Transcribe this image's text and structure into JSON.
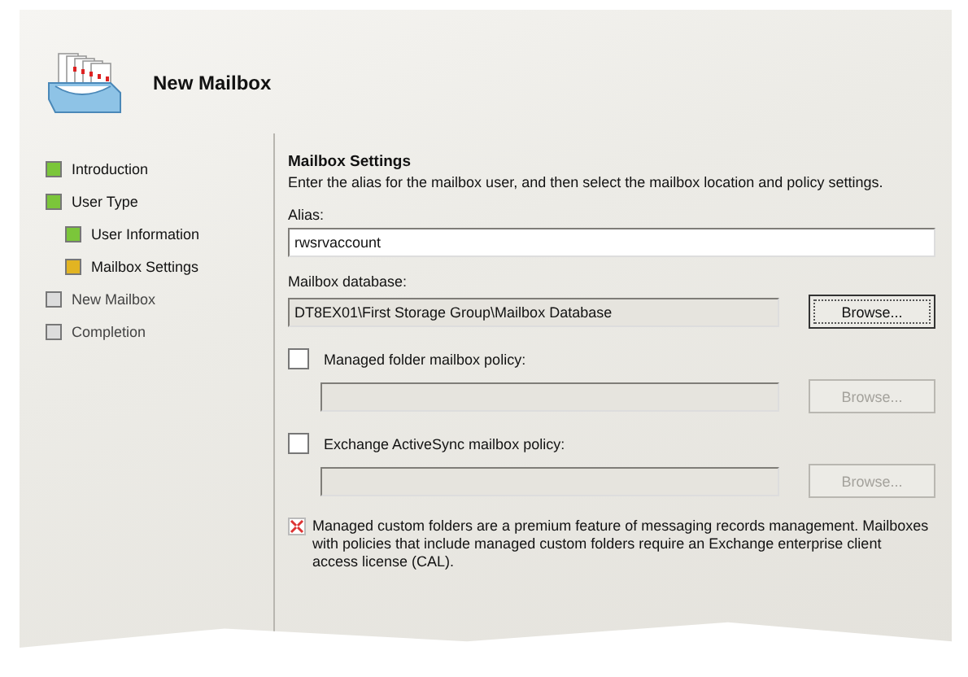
{
  "wizard": {
    "title": "New Mailbox"
  },
  "steps": [
    {
      "label": "Introduction",
      "kind": "done"
    },
    {
      "label": "User Type",
      "kind": "done",
      "children": [
        {
          "label": "User Information",
          "kind": "done"
        },
        {
          "label": "Mailbox Settings",
          "kind": "current"
        }
      ]
    },
    {
      "label": "New Mailbox",
      "kind": "pending"
    },
    {
      "label": "Completion",
      "kind": "pending"
    }
  ],
  "page": {
    "heading": "Mailbox Settings",
    "description": "Enter the alias for the mailbox user, and then select the mailbox location and policy settings.",
    "alias": {
      "label": "Alias:",
      "value": "rwsrvaccount"
    },
    "database": {
      "label": "Mailbox database:",
      "value": "DT8EX01\\First Storage Group\\Mailbox Database",
      "button": {
        "label": "Browse...",
        "disabled": false
      }
    },
    "policies": [
      {
        "label": "Managed folder mailbox policy:",
        "checked": false,
        "field_disabled": true,
        "button": {
          "label": "Browse...",
          "disabled": true
        }
      },
      {
        "label": "Exchange ActiveSync mailbox policy:",
        "checked": false,
        "field_disabled": true,
        "button": {
          "label": "Browse...",
          "disabled": true
        }
      }
    ],
    "note": "Managed custom folders are a premium feature of messaging records management. Mailboxes with policies that include managed custom folders require an Exchange enterprise client access license (CAL)."
  }
}
